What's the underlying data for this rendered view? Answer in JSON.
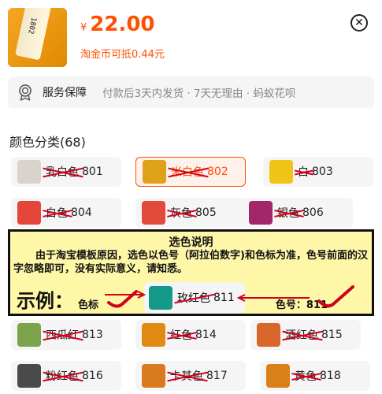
{
  "product": {
    "thumb_label": "1802",
    "currency": "¥",
    "price": "22.00",
    "coin_text": "淘金币可抵0.44元"
  },
  "service": {
    "title": "服务保障",
    "desc": "付款后3天内发货 · 7天无理由 · 蚂蚁花呗"
  },
  "colors": {
    "title": "颜色分类(68)",
    "items": [
      {
        "name": "乳白色",
        "code": "801",
        "swatch": "#d9d3cc",
        "selected": false
      },
      {
        "name": "米白色",
        "code": "802",
        "swatch": "#e0a11a",
        "selected": true
      },
      {
        "name": "白",
        "code": "803",
        "swatch": "#f0c419",
        "selected": false
      },
      {
        "name": "白色",
        "code": "804",
        "swatch": "#e5463b",
        "selected": false
      },
      {
        "name": "灰色",
        "code": "805",
        "swatch": "#e24a3c",
        "selected": false
      },
      {
        "name": "银色",
        "code": "806",
        "swatch": "#a3256b",
        "selected": false
      },
      {
        "name": "西瓜红",
        "code": "813",
        "swatch": "#7ba44c",
        "selected": false
      },
      {
        "name": "红色",
        "code": "814",
        "swatch": "#e08a14",
        "selected": false
      },
      {
        "name": "酒红色",
        "code": "815",
        "swatch": "#d9662a",
        "selected": false
      },
      {
        "name": "粉红色",
        "code": "816",
        "swatch": "#4a4a4a",
        "selected": false
      },
      {
        "name": "卡其色",
        "code": "817",
        "swatch": "#d97a1e",
        "selected": false
      },
      {
        "name": "黄色",
        "code": "818",
        "swatch": "#d98019",
        "selected": false
      }
    ]
  },
  "notice": {
    "title": "选色说明",
    "body": "由于淘宝模板原因，选色以色号（阿拉伯数字)和色标为准，色号前面的汉字忽略即可，没有实际意义，请知悉。",
    "example": "示例：",
    "swatch_tag": "色标",
    "demo_name": "玫红色",
    "demo_code": "811",
    "demo_swatch": "#159a8a",
    "code_label": "色号：811"
  },
  "accent": "#ff5000"
}
